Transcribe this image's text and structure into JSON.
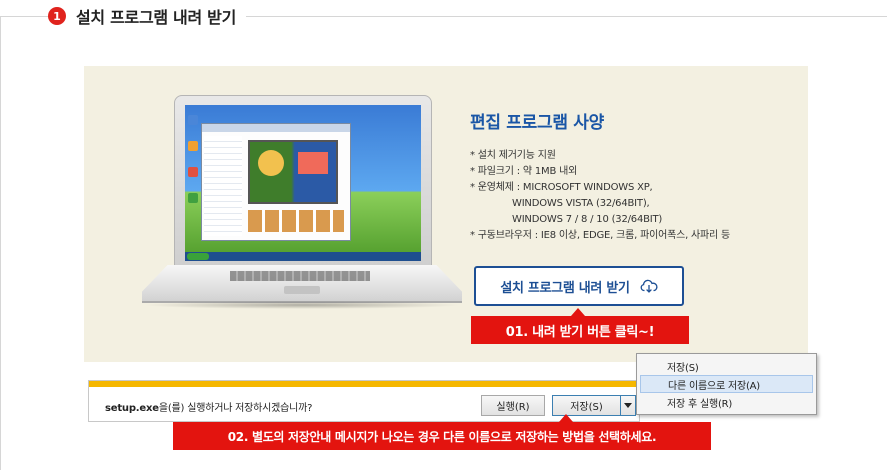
{
  "section": {
    "number": "1",
    "title": "설치 프로그램 내려 받기"
  },
  "specs": {
    "title": "편집 프로그램 사양",
    "items": [
      "* 설치 제거기능 지원",
      "* 파일크기 : 약 1MB 내외",
      "* 운영체제 : MICROSOFT WINDOWS XP,",
      "WINDOWS VISTA (32/64BIT),",
      "WINDOWS 7 / 8 / 10 (32/64BIT)",
      "* 구동브라우저 : IE8 이상, EDGE, 크롬, 파이어폭스, 사파리 등"
    ]
  },
  "download_button": {
    "label": "설치 프로그램 내려 받기",
    "icon": "cloud-download-icon"
  },
  "callouts": {
    "step1": "01. 내려 받기 버튼 클릭~!",
    "step2": "02. 별도의 저장안내 메시지가 나오는 경우  다른 이름으로 저장하는 방법을 선택하세요."
  },
  "download_bar": {
    "filename": "setup.exe",
    "message": "을(를) 실행하거나 저장하시겠습니까?",
    "run_label": "실행(R)",
    "save_label": "저장(S)"
  },
  "context_menu": {
    "items": [
      "저장(S)",
      "다른 이름으로 저장(A)",
      "저장 후 실행(R)"
    ],
    "highlighted": "다른 이름으로 저장(A)"
  },
  "colors": {
    "accent_red": "#e3140f",
    "button_blue": "#1d4f94",
    "panel_beige": "#f3f0e1",
    "bar_yellow": "#f5b700"
  }
}
